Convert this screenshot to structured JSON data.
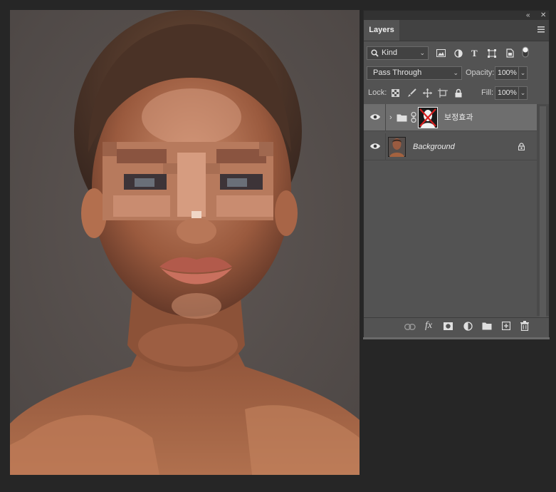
{
  "panel": {
    "tab": "Layers",
    "filter": {
      "kind_label": "Kind"
    },
    "blend": {
      "mode": "Pass Through",
      "opacity_label": "Opacity:",
      "opacity_value": "100%"
    },
    "lock": {
      "label": "Lock:",
      "fill_label": "Fill:",
      "fill_value": "100%"
    },
    "layers": [
      {
        "name": "보정효과",
        "type": "group",
        "selected": true,
        "visible": true
      },
      {
        "name": "Background",
        "type": "background",
        "selected": false,
        "visible": true,
        "locked": true
      }
    ]
  },
  "icons": {
    "top": [
      "collapse-icon",
      "close-icon"
    ],
    "filter": [
      "search-icon",
      "pixel-filter-icon",
      "adjustment-filter-icon",
      "type-filter-icon",
      "shape-filter-icon",
      "smart-object-filter-icon",
      "filter-toggle-icon"
    ],
    "lock": [
      "lock-transparent-icon",
      "lock-paint-icon",
      "lock-position-icon",
      "lock-artboard-icon",
      "lock-all-icon"
    ],
    "bottom": [
      "link-layers-icon",
      "fx-icon",
      "add-mask-icon",
      "adjustment-layer-icon",
      "new-group-icon",
      "new-layer-icon",
      "trash-icon"
    ]
  },
  "colors": {
    "panel_bg": "#535353",
    "selected_row": "#6e6e6e",
    "app_bg": "#262626",
    "mask_cross": "#d81f1f"
  }
}
